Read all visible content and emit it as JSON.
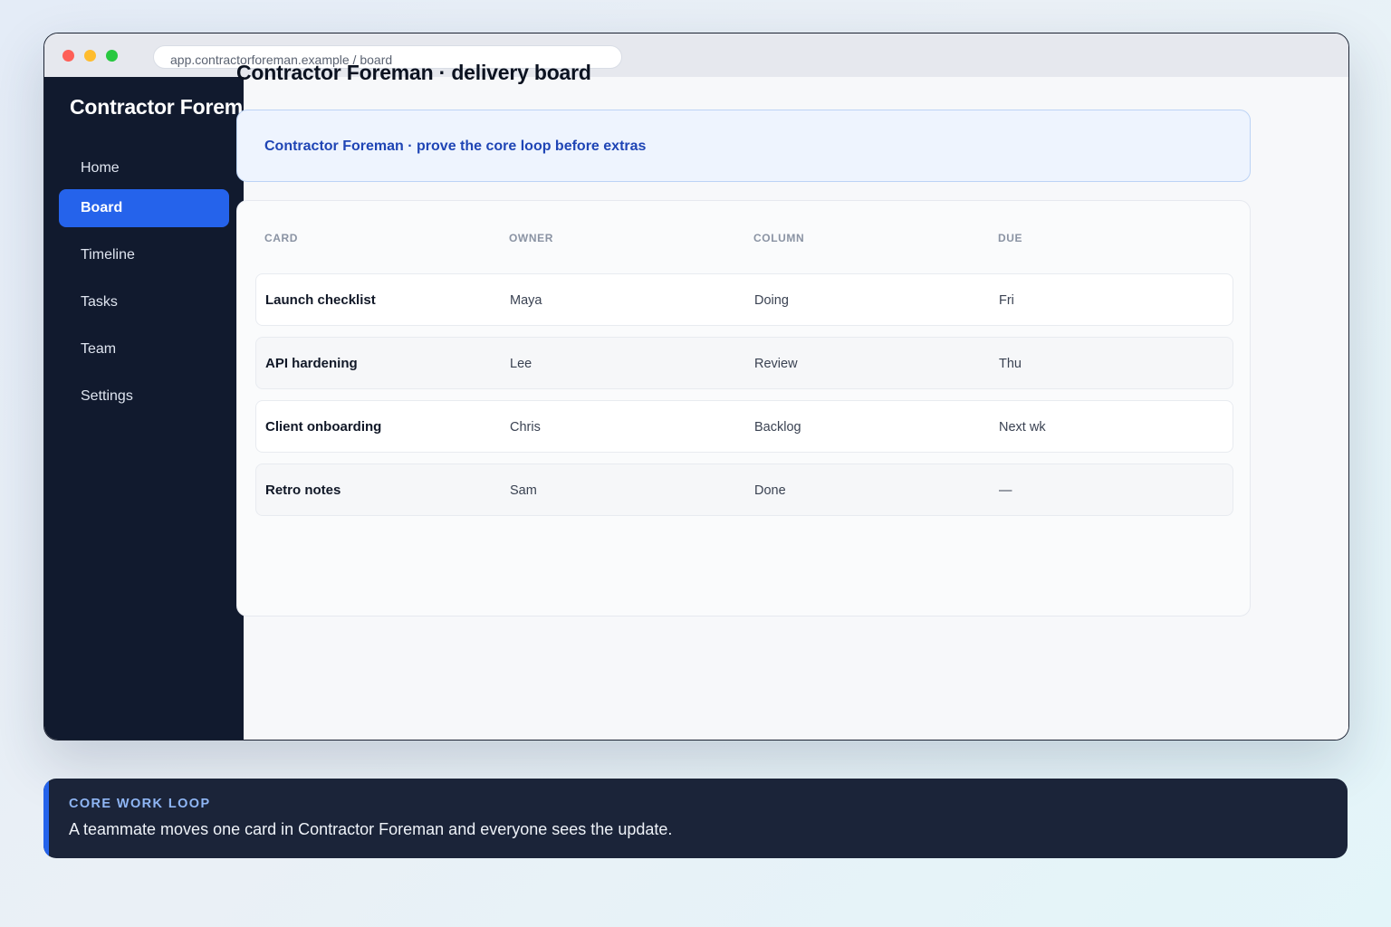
{
  "browser": {
    "address": "app.contractorforeman.example / board"
  },
  "sidebar": {
    "brand": "Contractor Foreman",
    "items": [
      {
        "label": "Home",
        "active": false
      },
      {
        "label": "Board",
        "active": true
      },
      {
        "label": "Timeline",
        "active": false
      },
      {
        "label": "Tasks",
        "active": false
      },
      {
        "label": "Team",
        "active": false
      },
      {
        "label": "Settings",
        "active": false
      }
    ]
  },
  "main": {
    "title": "Contractor Foreman · delivery board",
    "banner": "Contractor Foreman · prove the core loop before extras",
    "table": {
      "headers": [
        "CARD",
        "OWNER",
        "COLUMN",
        "DUE"
      ],
      "rows": [
        [
          "Launch checklist",
          "Maya",
          "Doing",
          "Fri"
        ],
        [
          "API hardening",
          "Lee",
          "Review",
          "Thu"
        ],
        [
          "Client onboarding",
          "Chris",
          "Backlog",
          "Next wk"
        ],
        [
          "Retro notes",
          "Sam",
          "Done",
          "—"
        ]
      ]
    }
  },
  "footer": {
    "kicker": "CORE WORK LOOP",
    "text": "A teammate moves one card in Contractor Foreman and everyone sees the update."
  },
  "colors": {
    "sidebar_bg": "#111a2e",
    "accent": "#2563eb",
    "banner_text": "#1f45b5",
    "footer_bg": "#1b2439"
  }
}
